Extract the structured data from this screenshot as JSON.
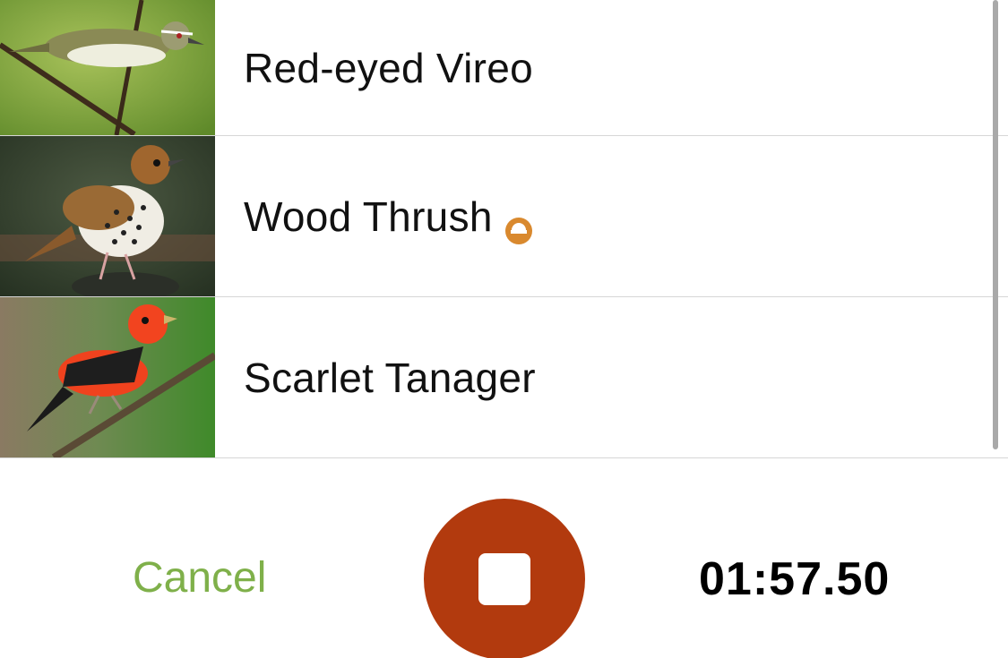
{
  "species_list": [
    {
      "name": "Red-eyed Vireo",
      "thumbnail": "red-eyed-vireo-photo",
      "badge": null
    },
    {
      "name": "Wood Thrush",
      "thumbnail": "wood-thrush-photo",
      "badge": "conservation-status-icon"
    },
    {
      "name": "Scarlet Tanager",
      "thumbnail": "scarlet-tanager-photo",
      "badge": null
    }
  ],
  "controls": {
    "cancel_label": "Cancel",
    "record_button_icon": "stop-icon",
    "timer": "01:57.50"
  },
  "colors": {
    "cancel_text": "#7fb04a",
    "record_button": "#b23a0e",
    "badge": "#d9892e",
    "divider": "#d6d6d6"
  }
}
